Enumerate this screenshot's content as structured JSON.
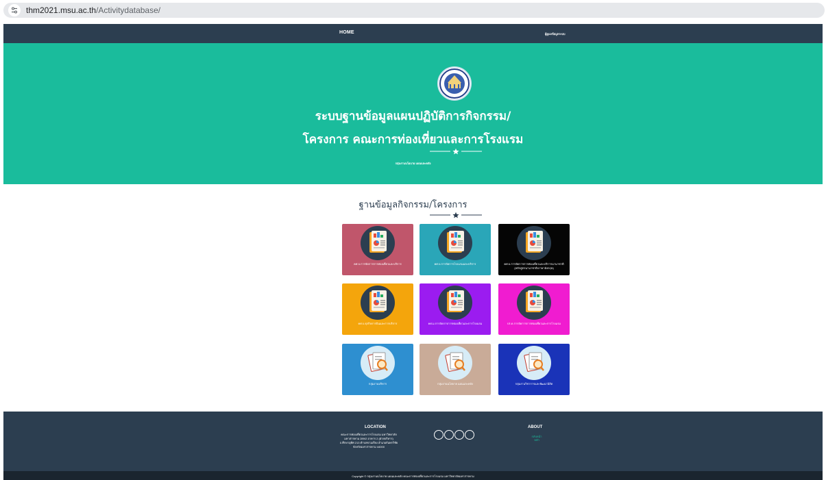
{
  "browser": {
    "url_host": "thm2021.msu.ac.th",
    "url_path": "/Activitydatabase/"
  },
  "nav": {
    "home": "HOME",
    "right": "ผู้ดูแลข้อมูลระบบ"
  },
  "hero": {
    "title_line1": "ระบบฐานข้อมูลแผนปฏิบัติการกิจกรรม/",
    "title_line2": "โครงการ คณะการท่องเที่ยวและการโรงแรม",
    "subtitle": "กลุ่มงานนโยบาย แผนและคลัง"
  },
  "section": {
    "title": "ฐานข้อมูลกิจกรรม/โครงการ"
  },
  "tiles": [
    {
      "label": "คศ.บ.การจัดการการท่องเที่ยวและบริการ",
      "color": "#c0566b"
    },
    {
      "label": "คศ.บ.การจัดการโรงแรมและบริการ",
      "color": "#2aa6b8"
    },
    {
      "label": "คศ.บ.การจัดการการท่องเที่ยวและบริการนานาชาติ (หลักสูตรนานาชาติ/ภาษาอังกฤษ)",
      "color": "#050505"
    },
    {
      "label": "คศ.บ.ธุรกิจการบินและการบริการ",
      "color": "#f4a50c"
    },
    {
      "label": "คศ.ม.การจัดการการท่องเที่ยวและการโรงแรม",
      "color": "#9b1cf0"
    },
    {
      "label": "ปร.ด.การจัดการการท่องเที่ยวและการโรงแรม",
      "color": "#f01cd0"
    },
    {
      "label": "กลุ่มงานบริหาร",
      "color": "#2e8fd0"
    },
    {
      "label": "กลุ่มงานนโยบาย แผนและคลัง",
      "color": "#c9ab98"
    },
    {
      "label": "กลุ่มงานวิชาการและพัฒนานิสิต",
      "color": "#1a33b8"
    }
  ],
  "footer": {
    "location_heading": "LOCATION",
    "location_line1": "คณะการท่องเที่ยวและการโรงแรม มหาวิทยาลัย",
    "location_line2": "มหาสารคาม 289/2 อาคาร 2 (ฝ่ายบริหาร)",
    "location_line3": "ถ.ศึกษาอุทิศ 213 ตำบลขามเรียง อำเภอกันทรวิชัย",
    "location_line4": "จังหวัดมหาสารคาม 44000",
    "about_heading": "ABOUT",
    "about_link1": "กลับหน้า",
    "about_link2": "หลัก",
    "copyright": "Copyright © กลุ่มงานนโยบาย แผนและคลัง คณะการท่องเที่ยวและการโรงแรม มหาวิทยาลัยมหาสารคาม"
  },
  "colors": {
    "navbar": "#2c3e50",
    "hero": "#1abc9c",
    "footer": "#2c3e50",
    "copyright_bar": "#1a252f"
  }
}
